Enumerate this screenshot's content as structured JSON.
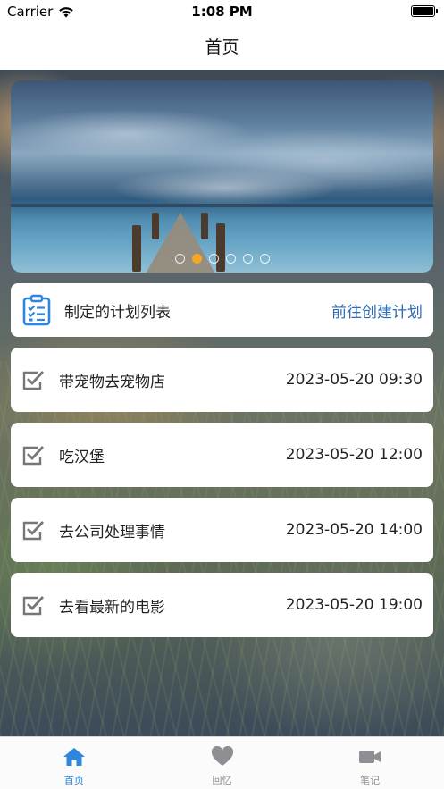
{
  "status_bar": {
    "carrier": "Carrier",
    "time": "1:08 PM"
  },
  "nav": {
    "title": "首页"
  },
  "banner": {
    "page_count": 6,
    "active_page": 1
  },
  "plan_header": {
    "title": "制定的计划列表",
    "link": "前往创建计划",
    "icon": "clipboard-list-icon"
  },
  "plans": [
    {
      "name": "带宠物去宠物店",
      "time": "2023-05-20 09:30"
    },
    {
      "name": "吃汉堡",
      "time": "2023-05-20 12:00"
    },
    {
      "name": "去公司处理事情",
      "time": "2023-05-20 14:00"
    },
    {
      "name": "去看最新的电影",
      "time": "2023-05-20 19:00"
    }
  ],
  "tabs": [
    {
      "label": "首页",
      "icon": "home-icon",
      "active": true
    },
    {
      "label": "回忆",
      "icon": "heart-icon",
      "active": false
    },
    {
      "label": "笔记",
      "icon": "video-camera-icon",
      "active": false
    }
  ],
  "colors": {
    "accent": "#2e86de",
    "link": "#2e6ab3",
    "page_indicator_active": "#f5a623",
    "icon_gray": "#8e8e93"
  }
}
